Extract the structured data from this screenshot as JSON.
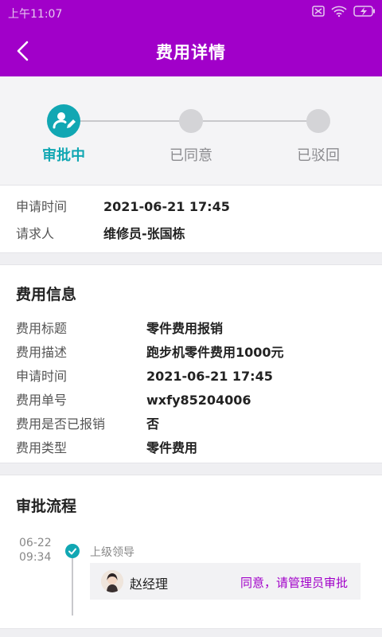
{
  "status_bar": {
    "time": "上午11:07"
  },
  "nav": {
    "title": "费用详情",
    "back_icon": "chevron-left-icon"
  },
  "steps": [
    {
      "label": "审批中",
      "state": "active",
      "icon": "approver-edit-icon"
    },
    {
      "label": "已同意",
      "state": "pending"
    },
    {
      "label": "已驳回",
      "state": "pending"
    }
  ],
  "request": {
    "rows": [
      {
        "key": "申请时间",
        "value": "2021-06-21 17:45"
      },
      {
        "key": "请求人",
        "value": "维修员-张国栋"
      }
    ]
  },
  "expense": {
    "title": "费用信息",
    "rows": [
      {
        "key": "费用标题",
        "value": "零件费用报销"
      },
      {
        "key": "费用描述",
        "value": "跑步机零件费用1000元"
      },
      {
        "key": "申请时间",
        "value": "2021-06-21 17:45"
      },
      {
        "key": "费用单号",
        "value": "wxfy85204006"
      },
      {
        "key": "费用是否已报销",
        "value": "否"
      },
      {
        "key": "费用类型",
        "value": "零件费用"
      }
    ]
  },
  "flow": {
    "title": "审批流程",
    "items": [
      {
        "date": "06-22",
        "time": "09:34",
        "stage": "上级领导",
        "approver": "赵经理",
        "comment": "同意，请管理员审批"
      }
    ]
  },
  "colors": {
    "brand": "#a100c9",
    "accent": "#11a7b3"
  }
}
